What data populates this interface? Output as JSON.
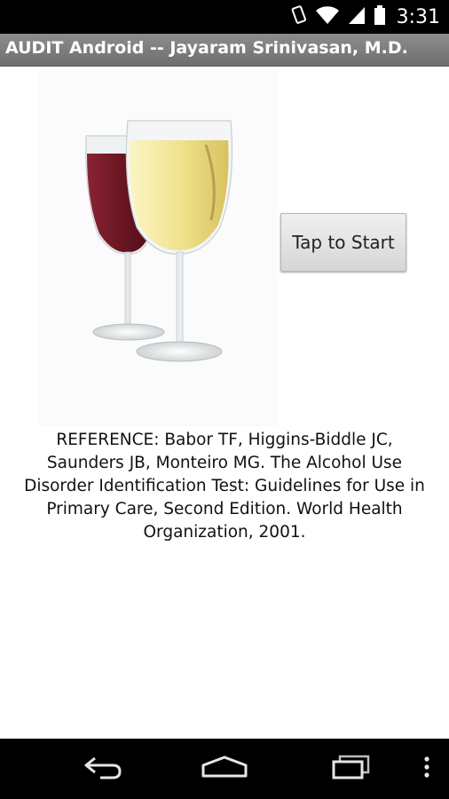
{
  "status_bar": {
    "time": "3:31",
    "icons": [
      "rotation-lock-icon",
      "wifi-icon",
      "signal-icon",
      "battery-icon"
    ]
  },
  "app_title": "AUDIT Android -- Jayaram Srinivasan, M.D.",
  "start_button_label": "Tap to Start",
  "reference_lines": [
    "REFERENCE: Babor TF, Higgins-Biddle JC,",
    "Saunders JB, Monteiro MG. The Alcohol Use",
    "Disorder Identification Test: Guidelines for Use in",
    "Primary Care, Second Edition. World Health",
    "Organization, 2001."
  ],
  "nav_bar": {
    "icons": [
      "back-icon",
      "home-icon",
      "recent-apps-icon",
      "overflow-menu-icon"
    ]
  },
  "colors": {
    "red_wine": "#7a1f2a",
    "white_wine": "#f3e9a2",
    "title_bar": "#7d7d7d"
  }
}
